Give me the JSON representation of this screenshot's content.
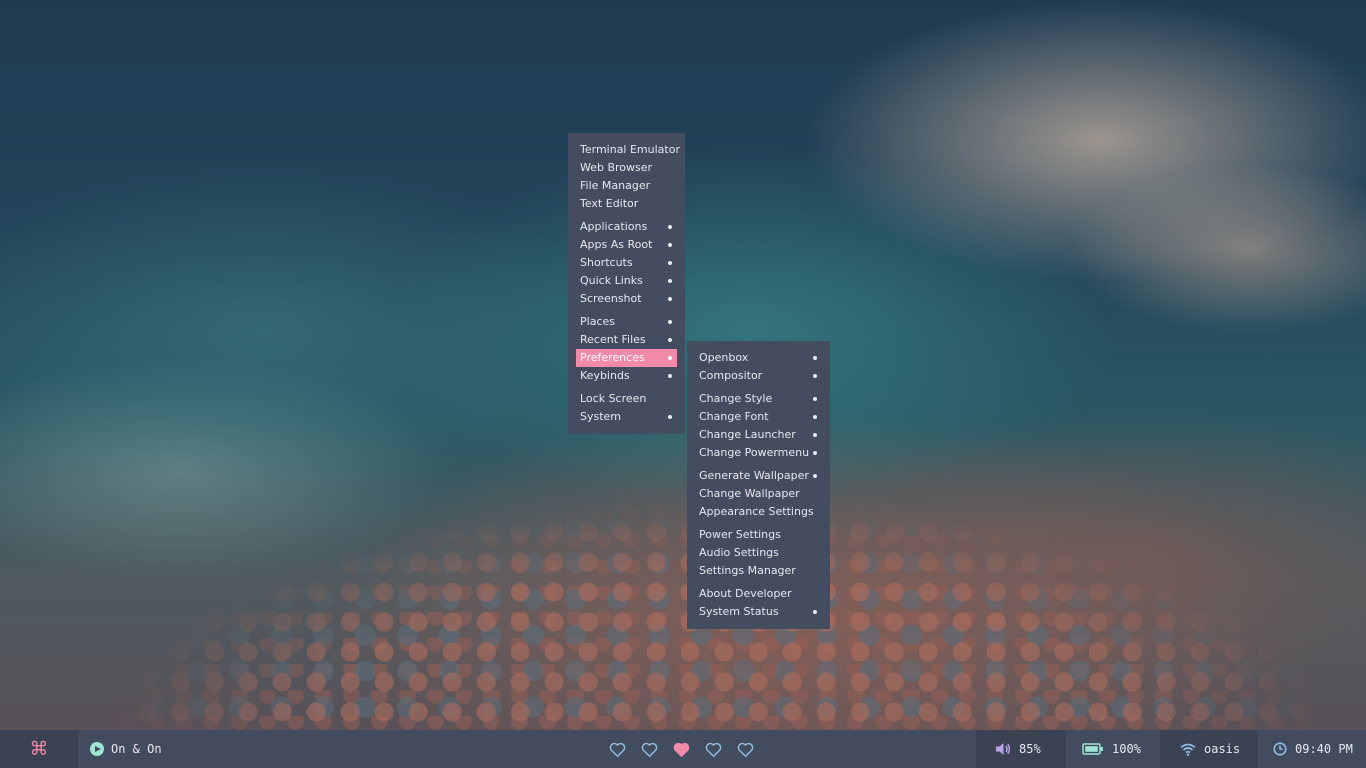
{
  "desktop": {
    "wallpaper": "ocean-waves-and-rocks"
  },
  "main_menu": {
    "items": [
      {
        "label": "Terminal Emulator",
        "submenu": false
      },
      {
        "label": "Web Browser",
        "submenu": false
      },
      {
        "label": "File Manager",
        "submenu": false
      },
      {
        "label": "Text Editor",
        "submenu": false
      },
      {
        "label": "Applications",
        "submenu": true
      },
      {
        "label": "Apps As Root",
        "submenu": true
      },
      {
        "label": "Shortcuts",
        "submenu": true
      },
      {
        "label": "Quick Links",
        "submenu": true
      },
      {
        "label": "Screenshot",
        "submenu": true
      },
      {
        "label": "Places",
        "submenu": true
      },
      {
        "label": "Recent Files",
        "submenu": true
      },
      {
        "label": "Preferences",
        "submenu": true,
        "active": true
      },
      {
        "label": "Keybinds",
        "submenu": true
      },
      {
        "label": "Lock Screen",
        "submenu": false
      },
      {
        "label": "System",
        "submenu": true
      }
    ]
  },
  "preferences_menu": {
    "items": [
      {
        "label": "Openbox",
        "submenu": true
      },
      {
        "label": "Compositor",
        "submenu": true
      },
      {
        "label": "Change Style",
        "submenu": true
      },
      {
        "label": "Change Font",
        "submenu": true
      },
      {
        "label": "Change Launcher",
        "submenu": true
      },
      {
        "label": "Change Powermenu",
        "submenu": true
      },
      {
        "label": "Generate Wallpaper",
        "submenu": true
      },
      {
        "label": "Change Wallpaper",
        "submenu": false
      },
      {
        "label": "Appearance Settings",
        "submenu": false
      },
      {
        "label": "Power Settings",
        "submenu": false
      },
      {
        "label": "Audio Settings",
        "submenu": false
      },
      {
        "label": "Settings Manager",
        "submenu": false
      },
      {
        "label": "About Developer",
        "submenu": false
      },
      {
        "label": "System Status",
        "submenu": true
      }
    ]
  },
  "panel": {
    "launcher_icon": "command-icon",
    "launcher_glyph": "⌘",
    "music": {
      "icon": "play-icon",
      "track": "On & On"
    },
    "workspaces": [
      {
        "icon": "heart-outline-icon",
        "active": false
      },
      {
        "icon": "heart-outline-icon",
        "active": false
      },
      {
        "icon": "heart-filled-icon",
        "active": true
      },
      {
        "icon": "heart-outline-icon",
        "active": false
      },
      {
        "icon": "heart-outline-icon",
        "active": false
      }
    ],
    "volume": {
      "icon": "volume-icon",
      "value": "85%"
    },
    "battery": {
      "icon": "battery-icon",
      "value": "100%"
    },
    "network": {
      "icon": "wifi-icon",
      "value": "oasis"
    },
    "clock": {
      "icon": "clock-icon",
      "value": "09:40 PM"
    }
  },
  "colors": {
    "menu_bg": "#444c5f",
    "menu_text": "#e6e9ef",
    "accent_pink": "#f28aa9",
    "panel_bg": "#434c5e",
    "panel_bg_alt": "#3b4254",
    "icon_mint": "#9ee6d4",
    "icon_sky": "#8fbfe6",
    "icon_violet": "#b9a2e6"
  }
}
